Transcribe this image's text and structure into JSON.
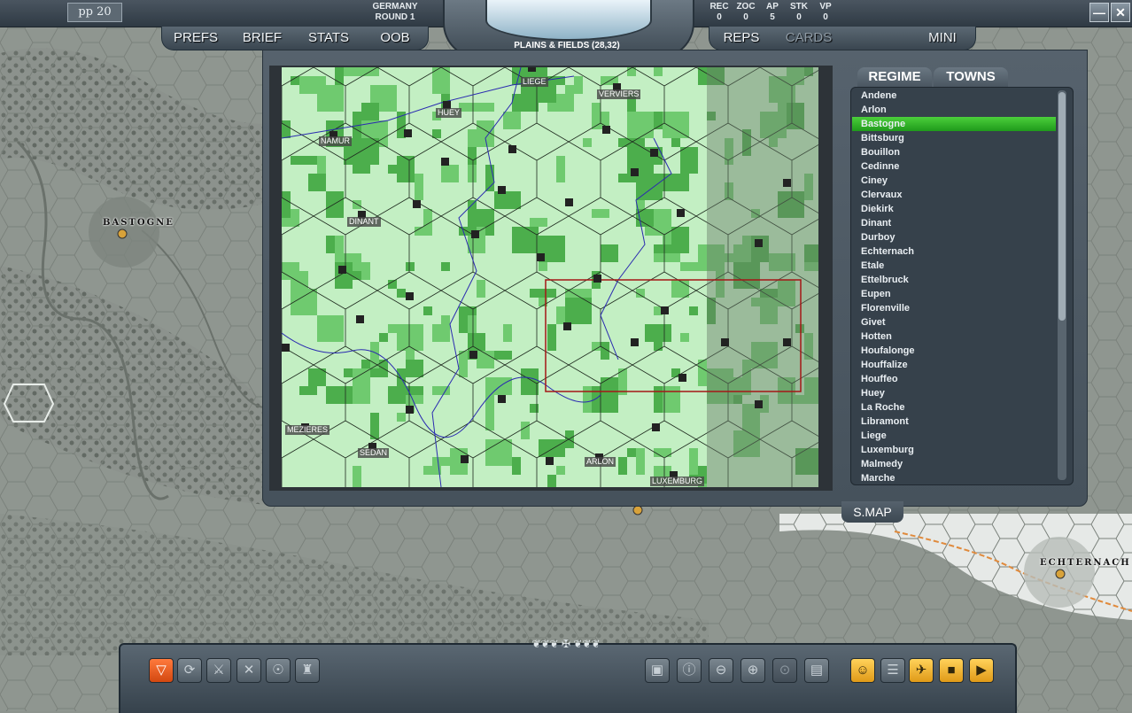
{
  "header": {
    "pp_label": "pp",
    "pp_value": "20",
    "side": "GERMANY",
    "round": "ROUND  1",
    "terrain": "PLAINS & FIELDS (28,32)",
    "stats": [
      {
        "label": "REC",
        "value": "0"
      },
      {
        "label": "ZOC",
        "value": "0"
      },
      {
        "label": "AP",
        "value": "5"
      },
      {
        "label": "STK",
        "value": "0"
      },
      {
        "label": "VP",
        "value": "0"
      }
    ]
  },
  "menu": {
    "prefs": "PREFS",
    "brief": "BRIEF",
    "stats": "STATS",
    "oob": "OOB",
    "reps": "REPS",
    "cards": "CARDS",
    "mini": "MINI"
  },
  "window_controls": {
    "minimize": "—",
    "close": "✕"
  },
  "tabs": {
    "regime": "REGIME",
    "towns": "TOWNS"
  },
  "towns": [
    "Andene",
    "Arlon",
    "Bastogne",
    "Bittsburg",
    "Bouillon",
    "Cedinne",
    "Ciney",
    "Clervaux",
    "Diekirk",
    "Dinant",
    "Durboy",
    "Echternach",
    "Etale",
    "Ettelbruck",
    "Eupen",
    "Florenville",
    "Givet",
    "Hotten",
    "Houfalonge",
    "Houffalize",
    "Houffeo",
    "Huey",
    "La Roche",
    "Libramont",
    "Liege",
    "Luxemburg",
    "Malmedy",
    "Marche"
  ],
  "selected_town": "Bastogne",
  "minimap_towns": [
    "LIEGE",
    "VERVIERS",
    "HUEY",
    "NAMUR",
    "DINANT",
    "MEZIERES",
    "SEDAN",
    "ARLON",
    "LUXEMBURG"
  ],
  "smap_label": "S.MAP",
  "map_labels": {
    "bastogne": "BASTOGNE",
    "echternach": "ECHTERNACH"
  },
  "toolbar_icons": [
    "next-unit-icon",
    "cycle-units-icon",
    "artillery-icon",
    "attack-icon",
    "engineer-icon",
    "tank-icon",
    "supply-icon",
    "unit-info-icon",
    "zoom-out-icon",
    "zoom-in-icon",
    "zoom-reset-icon",
    "cards-icon",
    "hq-icon",
    "orders-icon",
    "air-icon",
    "save-icon",
    "end-turn-icon"
  ],
  "ornament": "❦❦❦ ✠ ❦❦❦"
}
